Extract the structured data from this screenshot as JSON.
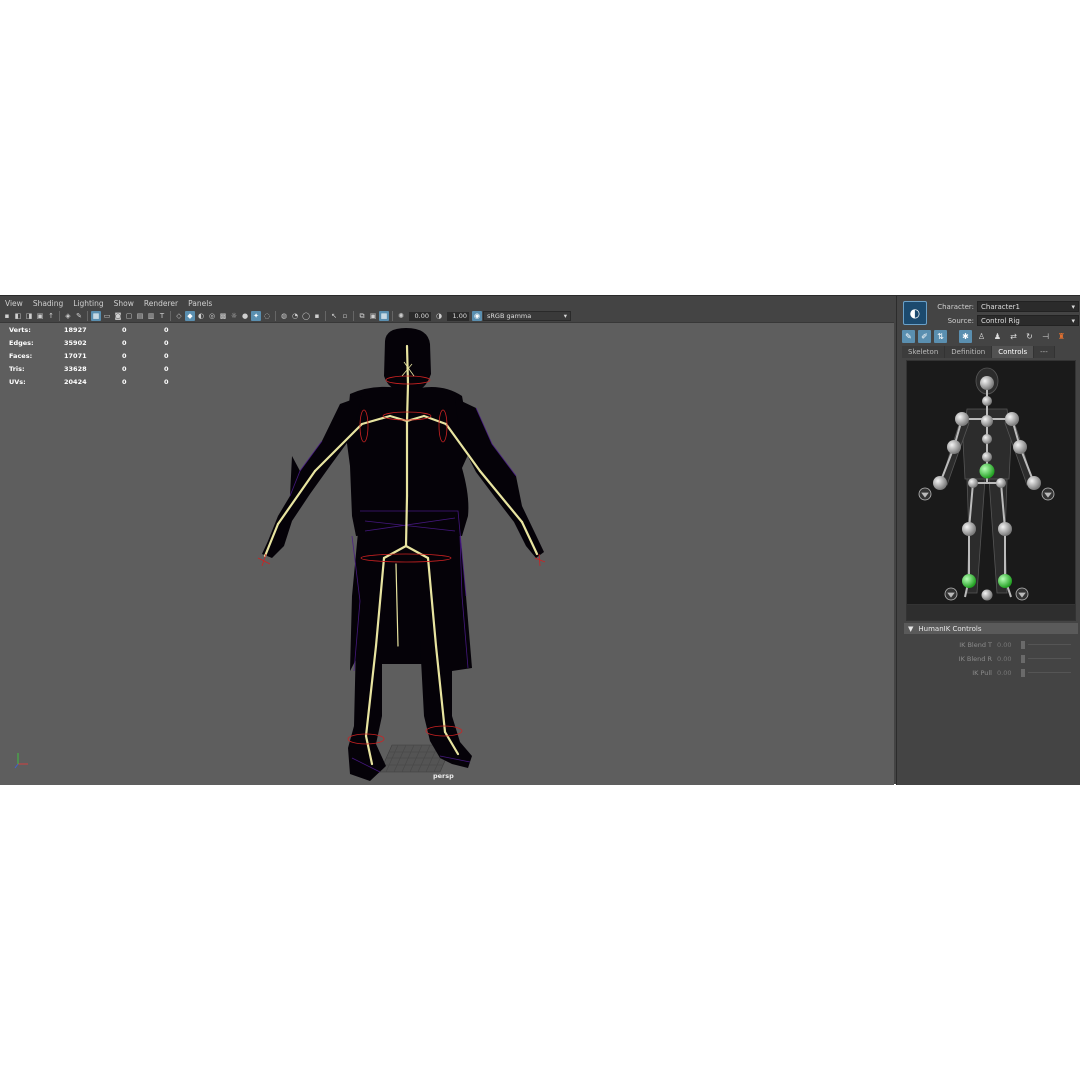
{
  "menu": [
    "View",
    "Shading",
    "Lighting",
    "Show",
    "Renderer",
    "Panels"
  ],
  "toolbar": {
    "exposure": "0.00",
    "gamma": "1.00",
    "color_space": "sRGB gamma"
  },
  "hud": {
    "rows": [
      {
        "label": "Verts:",
        "v1": "18927",
        "v2": "0",
        "v3": "0"
      },
      {
        "label": "Edges:",
        "v1": "35902",
        "v2": "0",
        "v3": "0"
      },
      {
        "label": "Faces:",
        "v1": "17071",
        "v2": "0",
        "v3": "0"
      },
      {
        "label": "Tris:",
        "v1": "33628",
        "v2": "0",
        "v3": "0"
      },
      {
        "label": "UVs:",
        "v1": "20424",
        "v2": "0",
        "v3": "0"
      }
    ]
  },
  "viewport": {
    "camera": "persp"
  },
  "panel": {
    "character_label": "Character:",
    "character_value": "Character1",
    "source_label": "Source:",
    "source_value": "Control Rig",
    "tabs": [
      "Skeleton",
      "Definition",
      "Controls",
      "---"
    ],
    "active_tab": "Controls",
    "section_title": "HumanIK Controls",
    "attributes": [
      {
        "label": "IK Blend T",
        "value": "0.00"
      },
      {
        "label": "IK Blend R",
        "value": "0.00"
      },
      {
        "label": "IK Pull",
        "value": "0.00"
      }
    ]
  },
  "colors": {
    "accent": "#5a8fb0",
    "viewport_bg": "#5e5e5e",
    "panel_bg": "#444444",
    "joint_active": "#4fd04f",
    "bone": "#e8e4a0"
  }
}
